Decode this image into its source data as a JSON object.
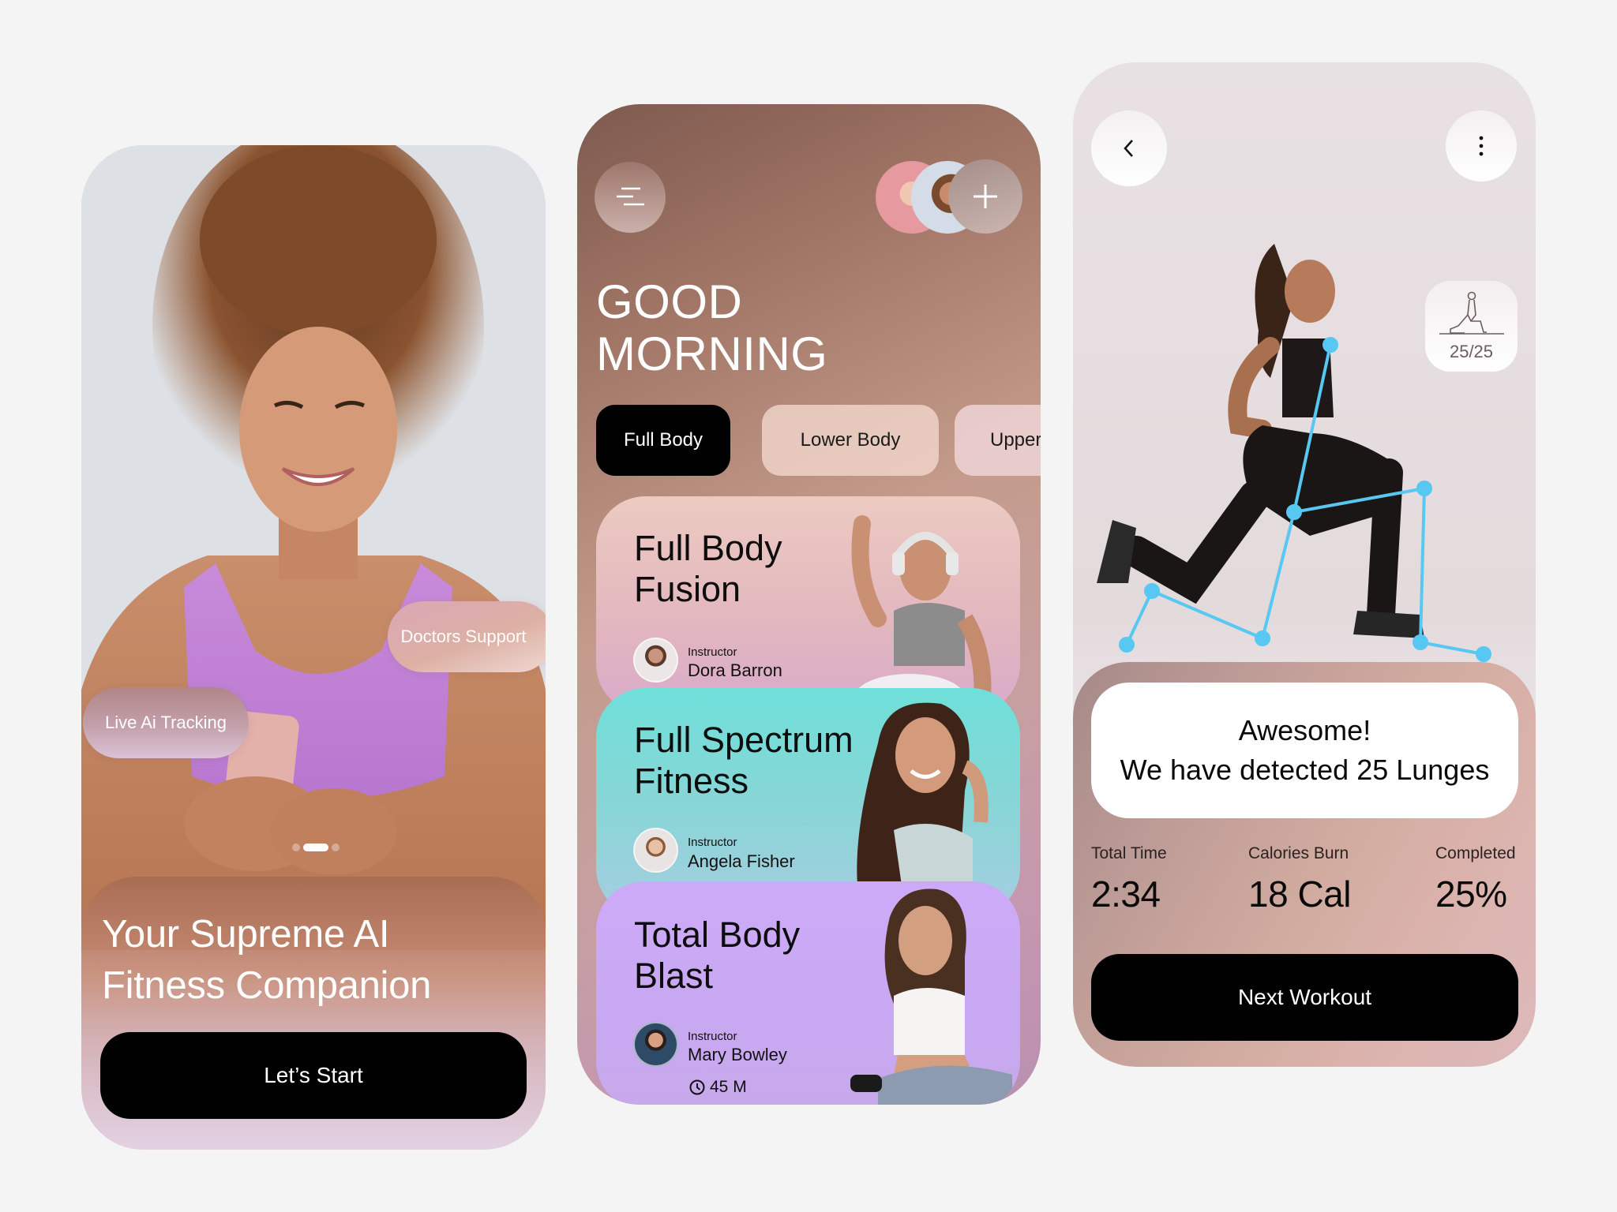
{
  "onboarding": {
    "chips": {
      "live_tracking": "Live Ai Tracking",
      "doctors_support": "Doctors Support"
    },
    "pager": {
      "pages": 3,
      "active": 1
    },
    "headline_line1": "Your Supreme AI",
    "headline_line2": "Fitness Companion",
    "cta_label": "Let’s Start",
    "icons": {
      "pager": "page-indicator"
    }
  },
  "home": {
    "greeting_line1": "GOOD",
    "greeting_line2": "MORNING",
    "icons": {
      "menu": "menu-icon",
      "add": "plus-icon",
      "clock": "clock-icon"
    },
    "tabs": [
      {
        "label": "Full Body",
        "active": true
      },
      {
        "label": "Lower Body",
        "active": false
      },
      {
        "label": "Upper",
        "active": false
      }
    ],
    "workouts": [
      {
        "title_line1": "Full Body",
        "title_line2": "Fusion",
        "instructor_label": "Instructor",
        "instructor_name": "Dora Barron",
        "color": "#e8c1c0"
      },
      {
        "title_line1": "Full Spectrum",
        "title_line2": "Fitness",
        "instructor_label": "Instructor",
        "instructor_name": "Angela Fisher",
        "color": "#72ded8"
      },
      {
        "title_line1": "Total Body",
        "title_line2": "Blast",
        "instructor_label": "Instructor",
        "instructor_name": "Mary Bowley",
        "duration": "45 M",
        "color": "#cba9f5"
      }
    ]
  },
  "tracking": {
    "icons": {
      "back": "chevron-left-icon",
      "more": "more-vertical-icon",
      "exercise": "lunge-figure-icon"
    },
    "rep_counter": "25/25",
    "skeleton_color": "#56c8f2",
    "alert_title": "Awesome!",
    "alert_message": "We have detected 25 Lunges",
    "stats": [
      {
        "label": "Total Time",
        "value": "2:34"
      },
      {
        "label": "Calories Burn",
        "value": "18 Cal"
      },
      {
        "label": "Completed",
        "value": "25%"
      }
    ],
    "cta_label": "Next Workout"
  }
}
